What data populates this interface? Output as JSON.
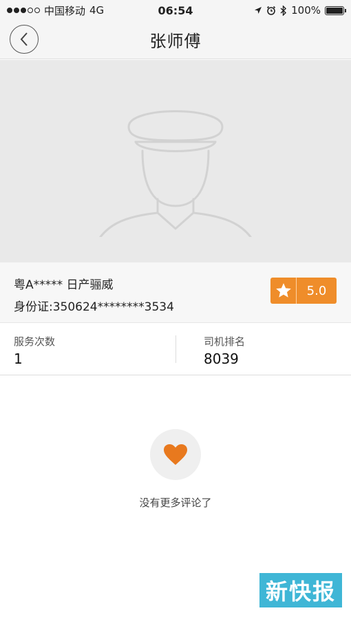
{
  "status_bar": {
    "carrier": "中国移动",
    "network": "4G",
    "time": "06:54",
    "battery": "100%"
  },
  "nav": {
    "title": "张师傅",
    "back_icon": "chevron-left-icon"
  },
  "driver": {
    "plate_and_car": "粤A***** 日产骊威",
    "id_card": "身份证:350624********3534",
    "rating": "5.0"
  },
  "stats": {
    "service_count_label": "服务次数",
    "service_count_value": "1",
    "rank_label": "司机排名",
    "rank_value": "8039"
  },
  "reviews": {
    "empty_text": "没有更多评论了"
  },
  "watermark": {
    "text": "新快报"
  },
  "colors": {
    "accent": "#ef8d2a",
    "heart": "#e8791e",
    "watermark_bg": "#3fb6d6"
  }
}
